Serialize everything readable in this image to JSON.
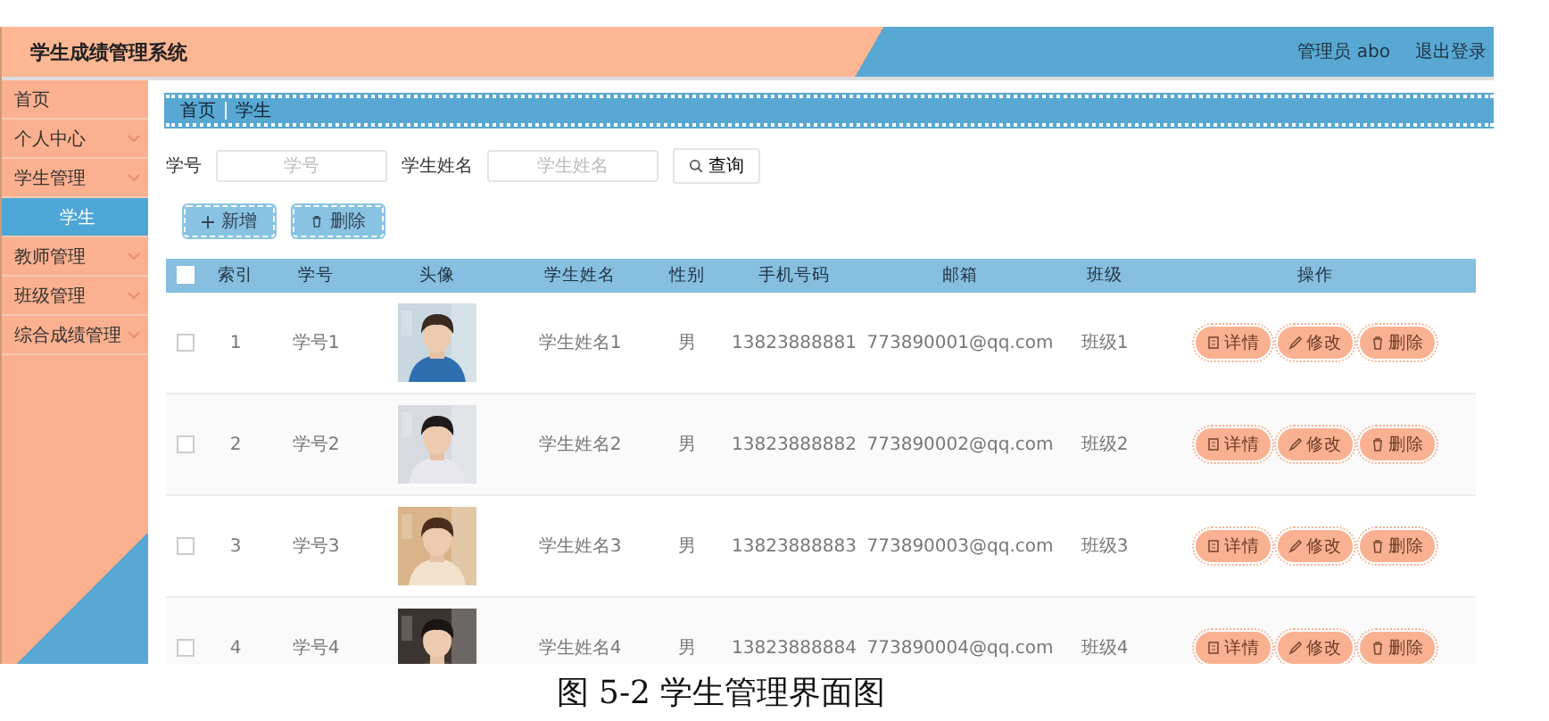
{
  "header": {
    "title": "学生成绩管理系统",
    "user": "管理员 abo",
    "logout": "退出登录"
  },
  "sidebar": {
    "items": [
      {
        "label": "首页",
        "kind": "link",
        "selected": false
      },
      {
        "label": "个人中心",
        "kind": "menu",
        "selected": false
      },
      {
        "label": "学生管理",
        "kind": "menu",
        "selected": false,
        "children": [
          {
            "label": "学生",
            "selected": true
          }
        ]
      },
      {
        "label": "教师管理",
        "kind": "menu",
        "selected": false
      },
      {
        "label": "班级管理",
        "kind": "menu",
        "selected": false
      },
      {
        "label": "综合成绩管理",
        "kind": "menu",
        "selected": false
      }
    ]
  },
  "breadcrumb": [
    "首页",
    "学生"
  ],
  "search": {
    "fields": [
      {
        "label": "学号",
        "placeholder": "学号"
      },
      {
        "label": "学生姓名",
        "placeholder": "学生姓名"
      }
    ],
    "button": "查询"
  },
  "actions": [
    "新增",
    "删除"
  ],
  "table": {
    "select_all": {
      "checked": false
    },
    "columns": [
      "索引",
      "学号",
      "头像",
      "学生姓名",
      "性别",
      "手机号码",
      "邮箱",
      "班级",
      "操作"
    ],
    "rows": [
      {
        "checked": false,
        "index": "1",
        "id": "学号1",
        "avatar": {
          "kind": "picture"
        },
        "name": "学生姓名1",
        "gender": "男",
        "phone": "13823888881",
        "email": "773890001@qq.com",
        "class": "班级1",
        "buttons": [
          "详情",
          "修改",
          "删除"
        ]
      },
      {
        "checked": false,
        "index": "2",
        "id": "学号2",
        "avatar": {
          "kind": "picture"
        },
        "name": "学生姓名2",
        "gender": "男",
        "phone": "13823888882",
        "email": "773890002@qq.com",
        "class": "班级2",
        "buttons": [
          "详情",
          "修改",
          "删除"
        ]
      },
      {
        "checked": false,
        "index": "3",
        "id": "学号3",
        "avatar": {
          "kind": "picture"
        },
        "name": "学生姓名3",
        "gender": "男",
        "phone": "13823888883",
        "email": "773890003@qq.com",
        "class": "班级3",
        "buttons": [
          "详情",
          "修改",
          "删除"
        ]
      },
      {
        "checked": false,
        "index": "4",
        "id": "学号4",
        "avatar": {
          "kind": "picture"
        },
        "name": "学生姓名4",
        "gender": "男",
        "phone": "13823888884",
        "email": "773890004@qq.com",
        "class": "班级4",
        "buttons": [
          "详情",
          "修改",
          "删除"
        ]
      }
    ]
  },
  "caption": "图 5-2 学生管理界面图"
}
